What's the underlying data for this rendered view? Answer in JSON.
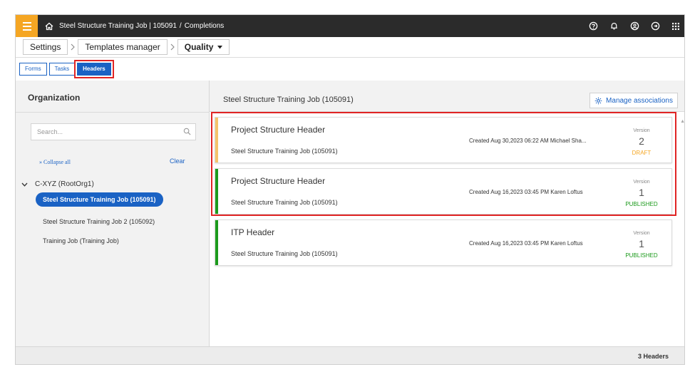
{
  "topbar": {
    "job_title": "Steel Structure Training Job | 105091",
    "separator": "/",
    "section": "Completions",
    "icons": [
      "help-icon",
      "bell-icon",
      "user-icon",
      "logout-icon",
      "apps-grid-icon"
    ],
    "accent_color": "#f5a623"
  },
  "breadcrumb": {
    "settings": "Settings",
    "templates_manager": "Templates manager",
    "quality": "Quality"
  },
  "tabs": {
    "forms": "Forms",
    "tasks": "Tasks",
    "headers": "Headers"
  },
  "left": {
    "title": "Organization",
    "search_placeholder": "Search...",
    "collapse_all": "» Collapse all",
    "clear": "Clear",
    "root": "C-XYZ (RootOrg1)",
    "items": [
      "Steel Structure Training Job (105091)",
      "Steel Structure Training Job 2 (105092)",
      "Training Job (Training Job)"
    ]
  },
  "right": {
    "title": "Steel Structure Training Job (105091)",
    "manage_associations": "Manage associations",
    "version_label": "Version",
    "cards": [
      {
        "title": "Project Structure Header",
        "subtitle": "Steel Structure Training Job (105091)",
        "meta": "Created Aug 30,2023 06:22 AM Michael Sha...",
        "version": "2",
        "status": "DRAFT",
        "status_color": "#f5a623",
        "stripe_color": "#f5c36b"
      },
      {
        "title": "Project Structure Header",
        "subtitle": "Steel Structure Training Job (105091)",
        "meta": "Created Aug 16,2023 03:45 PM Karen Loftus",
        "version": "1",
        "status": "PUBLISHED",
        "status_color": "#1c9a1c",
        "stripe_color": "#1c9a1c"
      },
      {
        "title": "ITP Header",
        "subtitle": "Steel Structure Training Job (105091)",
        "meta": "Created Aug 16,2023 03:45 PM Karen Loftus",
        "version": "1",
        "status": "PUBLISHED",
        "status_color": "#1c9a1c",
        "stripe_color": "#1c9a1c"
      }
    ],
    "count": "3 Headers"
  }
}
